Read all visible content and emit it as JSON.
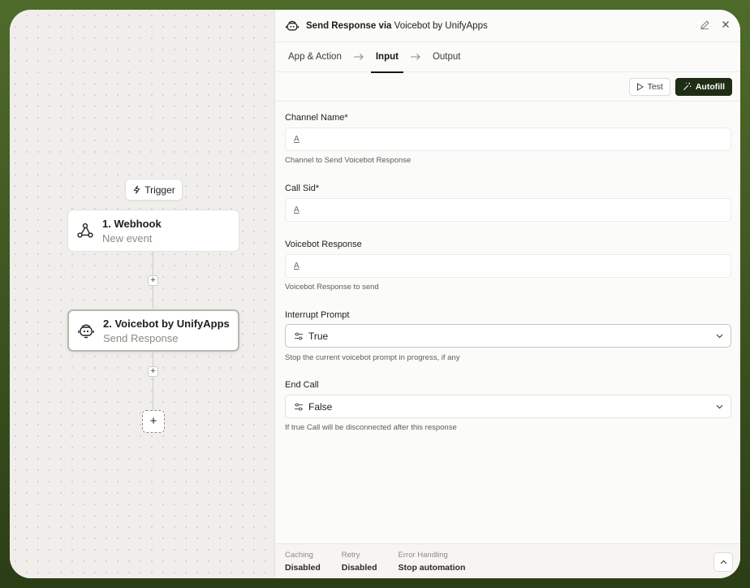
{
  "canvas": {
    "trigger_label": "Trigger",
    "nodes": [
      {
        "title": "1. Webhook",
        "subtitle": "New event",
        "icon": "webhook-icon"
      },
      {
        "title": "2. Voicebot by UnifyApps",
        "subtitle": "Send Response",
        "icon": "voicebot-icon"
      }
    ],
    "plus_symbol": "+"
  },
  "panel": {
    "title_prefix": "Send Response via ",
    "title_app": "Voicebot by UnifyApps",
    "tabs": [
      {
        "label": "App & Action"
      },
      {
        "label": "Input"
      },
      {
        "label": "Output"
      }
    ],
    "toolbar": {
      "test_label": "Test",
      "autofill_label": "Autofill"
    },
    "fields": [
      {
        "label": "Channel Name*",
        "value": "",
        "help": "Channel to Send Voicebot Response"
      },
      {
        "label": "Call Sid*",
        "value": "",
        "help": ""
      },
      {
        "label": "Voicebot Response",
        "value": "",
        "help": "Voicebot Response to send"
      },
      {
        "label": "Interrupt Prompt",
        "value": "True",
        "help": "Stop the current voicebot prompt in progress, if any"
      },
      {
        "label": "End Call",
        "value": "False",
        "help": "If true Call will be disconnected after this response"
      }
    ],
    "text_type_glyph": "A",
    "footer": {
      "caching": {
        "label": "Caching",
        "value": "Disabled"
      },
      "retry": {
        "label": "Retry",
        "value": "Disabled"
      },
      "error_handling": {
        "label": "Error Handling",
        "value": "Stop automation"
      }
    }
  },
  "colors": {
    "accent_dark": "#1f2d15",
    "frame_green": "#3c5320"
  }
}
